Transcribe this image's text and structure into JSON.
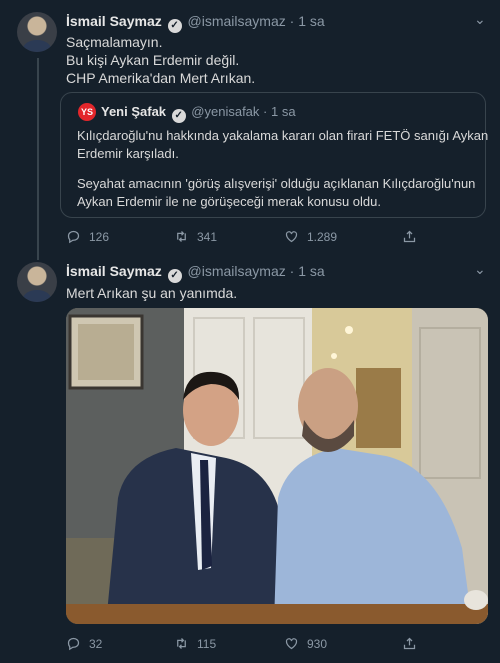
{
  "tweet1": {
    "name": "İsmail Saymaz",
    "handle": "@ismailsaymaz",
    "time": "· 1 sa",
    "lines": [
      "Saçmalamayın.",
      "Bu kişi Aykan Erdemir değil.",
      "CHP Amerika'dan Mert Arıkan."
    ],
    "replies": "126",
    "retweets": "341",
    "likes": "1.289"
  },
  "quote": {
    "logo_text": "YS",
    "name": "Yeni Şafak",
    "handle": "@yenisafak",
    "time": "· 1 sa",
    "lines": [
      "Kılıçdaroğlu'nu hakkında yakalama kararı olan firari FETÖ sanığı Aykan",
      "Erdemir karşıladı.",
      "Seyahat amacının 'görüş alışverişi' olduğu açıklanan Kılıçdaroğlu'nun",
      "Aykan Erdemir ile ne görüşeceği merak konusu oldu."
    ]
  },
  "tweet2": {
    "name": "İsmail Saymaz",
    "handle": "@ismailsaymaz",
    "time": "· 1 sa",
    "text": "Mert Arıkan şu an yanımda.",
    "replies": "32",
    "retweets": "115",
    "likes": "930"
  },
  "colors": {
    "background": "#15202b",
    "muted": "#8b98a5",
    "border": "#38444d",
    "text": "#d9d9d9"
  }
}
